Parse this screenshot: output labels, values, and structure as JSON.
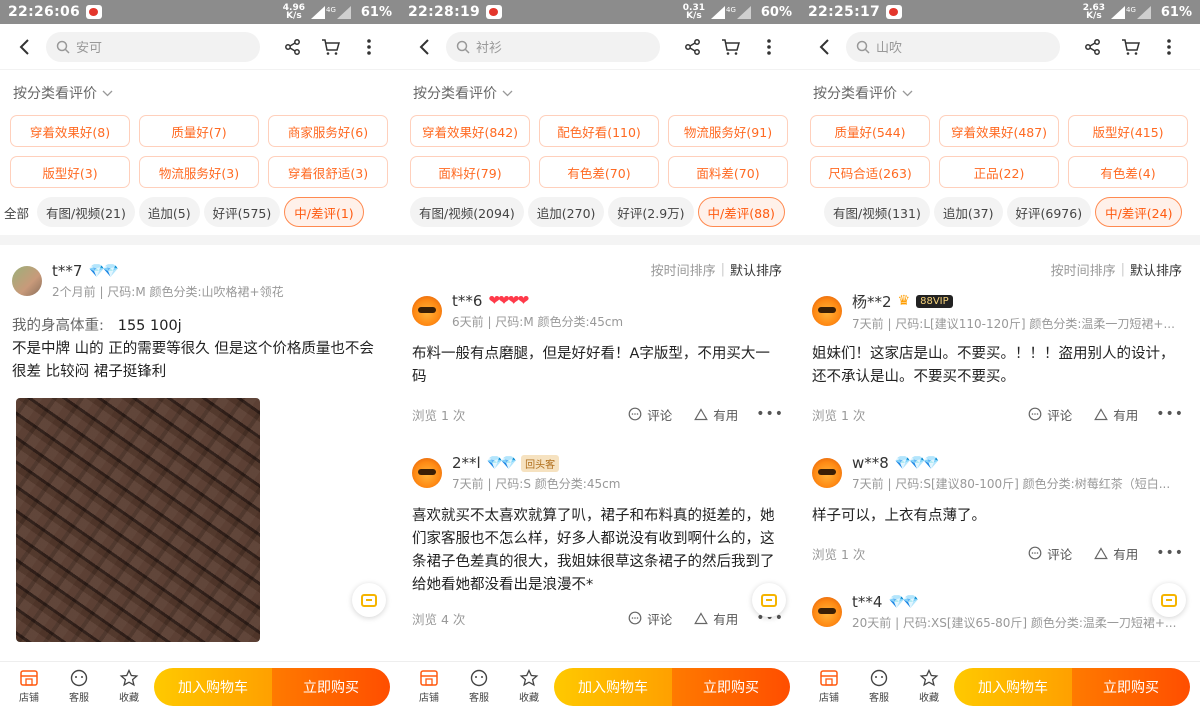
{
  "panels": [
    {
      "status": {
        "time": "22:26:06",
        "speed_top": "4.96",
        "speed_unit": "K/s",
        "battery": "61%"
      },
      "search_placeholder": "安可",
      "category_header": "按分类看评价",
      "tags": [
        "穿着效果好(8)",
        "质量好(7)",
        "商家服务好(6)",
        "版型好(3)",
        "物流服务好(3)",
        "穿着很舒适(3)"
      ],
      "filters": [
        "全部",
        "有图/视频(21)",
        "追加(5)",
        "好评(575)",
        "中/差评(1)"
      ],
      "reviews": [
        {
          "name": "t**7",
          "badge_gems": "💎💎",
          "meta": "2个月前 | 尺码:M 颜色分类:山吹格裙+领花",
          "spec_label": "我的身高体重:",
          "spec_value": "155 100j",
          "text": "不是中牌 山的 正的需要等很久 但是这个价格质量也不会很差 比较闷 裙子挺锋利"
        }
      ],
      "bottom": {
        "shop": "店铺",
        "service": "客服",
        "favorite": "收藏",
        "add_cart": "加入购物车",
        "buy_now": "立即购买"
      }
    },
    {
      "status": {
        "time": "22:28:19",
        "speed_top": "0.31",
        "speed_unit": "K/s",
        "battery": "60%"
      },
      "search_placeholder": "衬衫",
      "category_header": "按分类看评价",
      "tags": [
        "穿着效果好(842)",
        "配色好看(110)",
        "物流服务好(91)",
        "面料好(79)",
        "有色差(70)",
        "面料差(70)"
      ],
      "filters": [
        "有图/视频(2094)",
        "追加(270)",
        "好评(2.9万)",
        "中/差评(88)"
      ],
      "sort": {
        "by_time": "按时间排序",
        "default": "默认排序"
      },
      "reviews": [
        {
          "name": "t**6",
          "hearts": "❤❤❤❤",
          "meta": "6天前 | 尺码:M 颜色分类:45cm",
          "text": "布料一般有点磨腿，但是好好看！A字版型，不用买大一码",
          "views": "浏览 1 次"
        },
        {
          "name": "2**l",
          "badge_gems": "💎💎",
          "badge": "回头客",
          "meta": "7天前 | 尺码:S 颜色分类:45cm",
          "text": "喜欢就买不太喜欢就算了叭，裙子和布料真的挺差的，她们家客服也不怎么样，好多人都说没有收到啊什么的，这条裙子色差真的很大，我姐妹很草这条裙子的然后我到了给她看她都没看出是浪漫不*",
          "views": "浏览 4 次"
        }
      ],
      "actions": {
        "comment": "评论",
        "useful": "有用",
        "more": "•••"
      },
      "bottom": {
        "shop": "店铺",
        "service": "客服",
        "favorite": "收藏",
        "add_cart": "加入购物车",
        "buy_now": "立即购买"
      }
    },
    {
      "status": {
        "time": "22:25:17",
        "speed_top": "2.63",
        "speed_unit": "K/s",
        "battery": "61%"
      },
      "search_placeholder": "山吹",
      "category_header": "按分类看评价",
      "tags": [
        "质量好(544)",
        "穿着效果好(487)",
        "版型好(415)",
        "尺码合适(263)",
        "正品(22)",
        "有色差(4)"
      ],
      "filters": [
        "有图/视频(131)",
        "追加(37)",
        "好评(6976)",
        "中/差评(24)"
      ],
      "sort": {
        "by_time": "按时间排序",
        "default": "默认排序"
      },
      "reviews": [
        {
          "name": "杨**2",
          "vip": "88VIP",
          "meta": "7天前 | 尺码:L[建议110-120斤] 颜色分类:温柔一刀短裙+...",
          "text": "姐妹们！这家店是山。不要买。！！！盗用别人的设计，还不承认是山。不要买不要买。",
          "views": "浏览 1 次"
        },
        {
          "name": "w**8",
          "badge_gems": "💎💎💎",
          "meta": "7天前 | 尺码:S[建议80-100斤] 颜色分类:树莓红茶（短白...",
          "text": "样子可以，上衣有点薄了。",
          "views": "浏览 1 次"
        },
        {
          "name": "t**4",
          "badge_gems": "💎💎",
          "meta": "20天前 | 尺码:XS[建议65-80斤] 颜色分类:温柔一刀短裙+..."
        }
      ],
      "actions": {
        "comment": "评论",
        "useful": "有用",
        "more": "•••"
      },
      "bottom": {
        "shop": "店铺",
        "service": "客服",
        "favorite": "收藏",
        "add_cart": "加入购物车",
        "buy_now": "立即购买"
      }
    }
  ]
}
